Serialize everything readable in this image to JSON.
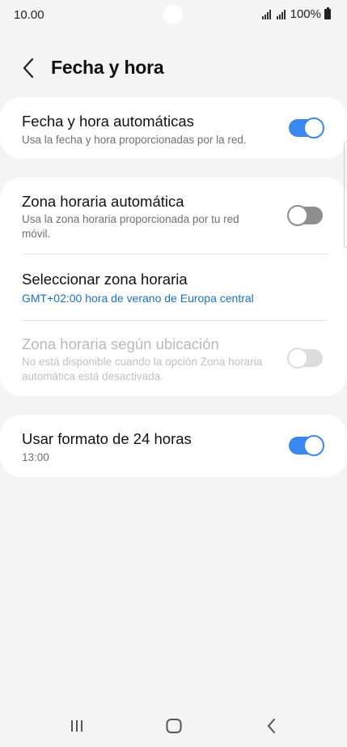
{
  "status_bar": {
    "time": "10.00",
    "battery": "100%",
    "icons": [
      "signal-icon",
      "signal-icon",
      "battery-icon"
    ]
  },
  "header": {
    "title": "Fecha y hora",
    "back_icon": "chevron-left-icon"
  },
  "section1": {
    "auto_datetime": {
      "title": "Fecha y hora automáticas",
      "subtitle": "Usa la fecha y hora proporcionadas por la red.",
      "toggle": "on"
    }
  },
  "section2": {
    "auto_timezone": {
      "title": "Zona horaria automática",
      "subtitle": "Usa la zona horaria proporcionada por tu red móvil.",
      "toggle": "off"
    },
    "select_timezone": {
      "title": "Seleccionar zona horaria",
      "value": "GMT+02:00 hora de verano de Europa central"
    },
    "location_timezone": {
      "title": "Zona horaria según ubicación",
      "subtitle": "No está disponible cuando la opción Zona horaria automática está desactivada.",
      "toggle": "disabled"
    }
  },
  "section3": {
    "format_24h": {
      "title": "Usar formato de 24 horas",
      "subtitle": "13:00",
      "toggle": "on"
    }
  },
  "nav_bar": {
    "icons": [
      "recents-icon",
      "home-icon",
      "back-icon"
    ]
  },
  "colors": {
    "accent": "#3b87f0",
    "link": "#1a72c6",
    "background": "#f4f4f4",
    "card": "#ffffff"
  }
}
